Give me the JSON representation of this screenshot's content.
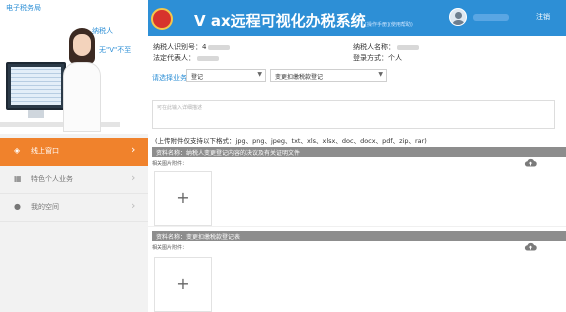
{
  "header": {
    "system_title": "V  ax远程可视化办税系统",
    "link_text": "[操作手册](使用帮助)",
    "logout_label": "注销"
  },
  "sidebar": {
    "top_caption": "电子税务局",
    "role_label": "纳税人",
    "welcome_text": "无\"V\"不至",
    "nav_items": [
      {
        "label": "线上窗口",
        "icon": "window-icon",
        "active": true
      },
      {
        "label": "特色个人业务",
        "icon": "grid-icon",
        "active": false
      },
      {
        "label": "我的空间",
        "icon": "user-icon",
        "active": false
      }
    ]
  },
  "taxpayer": {
    "id_label": "纳税人识别号：",
    "id_value": "4",
    "name_label": "纳税人名称：",
    "login_label": "登录方式：",
    "login_value": "个人",
    "registered_label": "法定代表人："
  },
  "business": {
    "label": "请选择业务",
    "select1_value": "登记",
    "select2_value": "变更扣缴税款登记"
  },
  "textarea": {
    "placeholder": "可在此输入详细描述"
  },
  "upload_note": "(上传附件仅支持以下格式：jpg、png、jpeg、txt、xls、xlsx、doc、docx、pdf、zip、rar)",
  "sections": [
    {
      "title": "资料名称：纳税人变更登记内容的决议及有关证明文件",
      "sub_label": "相关图片附件："
    },
    {
      "title": "资料名称：变更扣缴税款登记表",
      "sub_label": "相关图片附件："
    }
  ],
  "colors": {
    "header_blue": "#2d8fd6",
    "nav_active_orange": "#f0822c",
    "section_bar_gray": "#8d8d8d"
  }
}
